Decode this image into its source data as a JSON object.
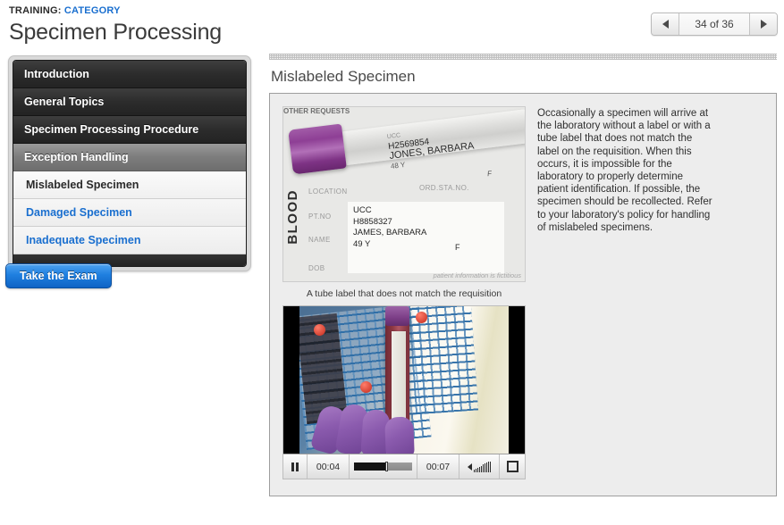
{
  "header": {
    "eyebrow_prefix": "TRAINING:",
    "eyebrow_category": "CATEGORY",
    "title": "Specimen Processing"
  },
  "pager": {
    "prev_icon": "triangle-left-icon",
    "next_icon": "triangle-right-icon",
    "label": "34 of 36",
    "current": 34,
    "total": 36
  },
  "sidebar": {
    "items": [
      {
        "label": "Introduction",
        "level": "top",
        "state": "normal"
      },
      {
        "label": "General Topics",
        "level": "top",
        "state": "normal"
      },
      {
        "label": "Specimen Processing Procedure",
        "level": "top",
        "state": "normal"
      },
      {
        "label": "Exception Handling",
        "level": "top",
        "state": "expanded"
      },
      {
        "label": "Mislabeled Specimen",
        "level": "sub",
        "state": "current"
      },
      {
        "label": "Damaged Specimen",
        "level": "sub",
        "state": "link"
      },
      {
        "label": "Inadequate Specimen",
        "level": "sub",
        "state": "link"
      }
    ],
    "exam_button": "Take the Exam"
  },
  "content": {
    "section_title": "Mislabeled Specimen",
    "body_text": "Occasionally a specimen will arrive at the laboratory without a label or with a tube label that does not match the label on the requisition. When this occurs, it is impossible for the laboratory to properly determine patient identification. If possible, the specimen should be recollected. Refer to your laboratory's policy for handling of mislabeled specimens.",
    "photo": {
      "caption": "A tube label that does not match the requisition",
      "form_heading": "OTHER REQUESTS",
      "side_text": "BLOOD",
      "field_location": "LOCATION",
      "field_ptno": "PT.NO",
      "field_name": "NAME",
      "field_dob": "DOB",
      "field_ord": "ORD.STA.NO.",
      "tube_line1": "UCC",
      "tube_line2": "H2569854",
      "tube_line3": "JONES, BARBARA",
      "tube_line4": "48 Y",
      "tube_sex": "F",
      "req_line1": "UCC",
      "req_line2": "H8858327",
      "req_line3": "JAMES, BARBARA",
      "req_line4": "49 Y",
      "req_sex": "F",
      "footnote": "patient information is fictitious"
    },
    "video": {
      "play_state_icon": "pause-icon",
      "current_time": "00:04",
      "duration": "00:07",
      "progress_percent": 55,
      "volume_icon": "volume-icon",
      "fullscreen_icon": "fullscreen-icon"
    }
  },
  "colors": {
    "link_blue": "#1a6fcf",
    "button_blue": "#1f7fe0",
    "menu_dark": "#2c2c2c",
    "menu_active_gray": "#7d7d7d",
    "panel_bg": "#ededed",
    "page_bg": "#ffffff"
  }
}
